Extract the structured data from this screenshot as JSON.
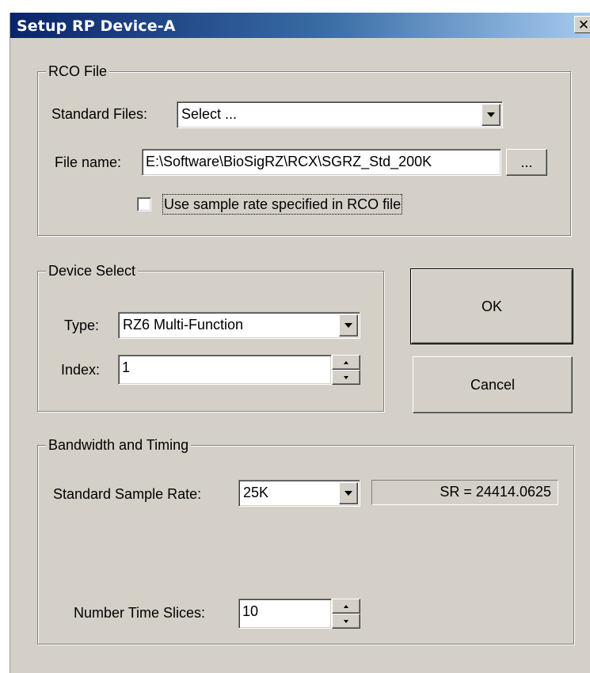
{
  "window": {
    "title": "Setup RP Device-A",
    "close_glyph": "✕"
  },
  "rco_file": {
    "group_label": "RCO File",
    "standard_files_label": "Standard Files:",
    "standard_files_value": "Select ...",
    "file_name_label": "File name:",
    "file_name_value": "E:\\Software\\BioSigRZ\\RCX\\SGRZ_Std_200K",
    "browse_label": "...",
    "use_sample_rate_label": "Use sample rate specified in RCO file",
    "use_sample_rate_checked": false
  },
  "device_select": {
    "group_label": "Device Select",
    "type_label": "Type:",
    "type_value": "RZ6  Multi-Function",
    "index_label": "Index:",
    "index_value": "1"
  },
  "buttons": {
    "ok_label": "OK",
    "cancel_label": "Cancel"
  },
  "bandwidth": {
    "group_label": "Bandwidth and Timing",
    "sample_rate_label": "Standard Sample Rate:",
    "sample_rate_value": "25K",
    "sr_readout": "SR =  24414.0625",
    "time_slices_label": "Number Time Slices:",
    "time_slices_value": "10"
  },
  "icons": {
    "dropdown": "chevron-down-icon",
    "spin_up": "spin-up-icon",
    "spin_down": "spin-down-icon"
  }
}
